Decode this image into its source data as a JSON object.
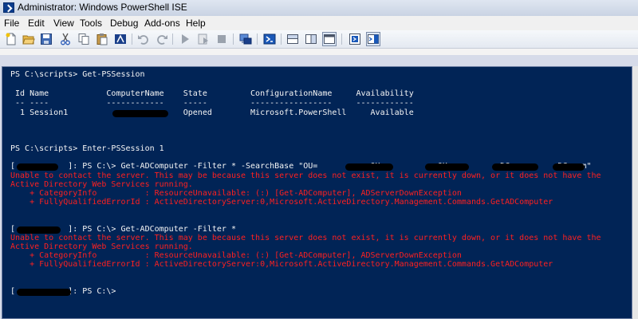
{
  "window": {
    "title": "Administrator: Windows PowerShell ISE"
  },
  "menu": {
    "items": [
      "File",
      "Edit",
      "View",
      "Tools",
      "Debug",
      "Add-ons",
      "Help"
    ]
  },
  "toolbar": {
    "buttons": [
      "new-icon",
      "open-icon",
      "save-icon",
      "cut-icon",
      "copy-icon",
      "paste-icon",
      "clear-console-icon",
      "undo-icon",
      "redo-icon",
      "run-script-icon",
      "run-selection-icon",
      "stop-icon",
      "remote-powershell-icon",
      "powershell-icon",
      "show-script-pane-top-icon",
      "show-script-pane-right-icon",
      "show-script-pane-max-icon",
      "show-commands-icon",
      "show-addon-icon"
    ]
  },
  "console": {
    "lines": [
      "PS C:\\scripts> Get-PSSession",
      " Id Name            ComputerName    State         ConfigurationName     Availability",
      " -- ----            ------------    -----         -----------------     ------------",
      "  1 Session1                        Opened        Microsoft.PowerShell     Available",
      "PS C:\\scripts> Enter-PSSession 1",
      "[           ]: PS C:\\> Get-ADComputer -Filter * -SearchBase \"OU=          ,OU=          ,OU=         ,DC=        ,DC=com\"",
      "Unable to contact the server. This may be because this server does not exist, it is currently down, or it does not have the",
      "Active Directory Web Services running.",
      "    + CategoryInfo          : ResourceUnavailable: (:) [Get-ADComputer], ADServerDownException",
      "    + FullyQualifiedErrorId : ActiveDirectoryServer:0,Microsoft.ActiveDirectory.Management.Commands.GetADComputer",
      "[           ]: PS C:\\> Get-ADComputer -Filter *",
      "Unable to contact the server. This may be because this server does not exist, it is currently down, or it does not have the",
      "Active Directory Web Services running.",
      "    + CategoryInfo          : ResourceUnavailable: (:) [Get-ADComputer], ADServerDownException",
      "    + FullyQualifiedErrorId : ActiveDirectoryServer:0,Microsoft.ActiveDirectory.Management.Commands.GetADComputer",
      "[           ]: PS C:\\>"
    ]
  },
  "colors": {
    "console_bg": "#012456",
    "console_fg": "#f5f5f5",
    "error_fg": "#ff2020"
  }
}
